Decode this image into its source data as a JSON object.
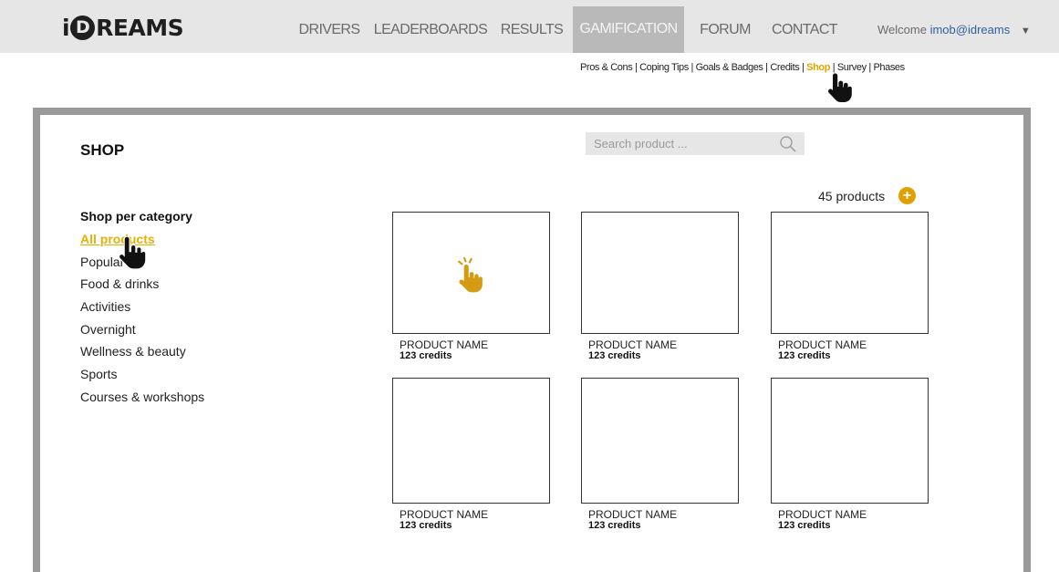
{
  "header": {
    "logo": {
      "prefix": "i",
      "mark": "D",
      "suffix": "REAMS"
    },
    "nav": [
      {
        "label": "DRIVERS",
        "active": false
      },
      {
        "label": "LEADERBOARDS",
        "active": false
      },
      {
        "label": "RESULTS",
        "active": false
      },
      {
        "label": "GAMIFICATION",
        "active": true
      },
      {
        "label": "FORUM",
        "active": false
      },
      {
        "label": "CONTACT",
        "active": false
      }
    ],
    "welcome": {
      "text": "Welcome",
      "user": "imob@idreams",
      "caret": "▼"
    }
  },
  "subnav": {
    "items": [
      "Pros & Cons",
      "Coping Tips",
      "Goals & Badges",
      "Credits",
      "Shop",
      "Survey",
      "Phases"
    ],
    "active": "Shop"
  },
  "page": {
    "title": "SHOP"
  },
  "search": {
    "placeholder": "Search product ..."
  },
  "results": {
    "count_label": "45 products",
    "add_symbol": "+"
  },
  "categories": {
    "heading": "Shop per category",
    "items": [
      "All products",
      "Popular",
      "Food & drinks",
      "Activities",
      "Overnight",
      "Wellness & beauty",
      "Sports",
      "Courses & workshops"
    ],
    "active": "All products"
  },
  "products": [
    {
      "name": "PRODUCT  NAME",
      "credits": "123 credits"
    },
    {
      "name": "PRODUCT  NAME",
      "credits": "123 credits"
    },
    {
      "name": "PRODUCT  NAME",
      "credits": "123 credits"
    },
    {
      "name": "PRODUCT  NAME",
      "credits": "123 credits"
    },
    {
      "name": "PRODUCT  NAME",
      "credits": "123 credits"
    },
    {
      "name": "PRODUCT  NAME",
      "credits": "123 credits"
    }
  ],
  "colors": {
    "accent": "#e0a000",
    "nav_active_bg": "#b9b9b9",
    "topbar_bg": "#e6e6e6",
    "panel_frame": "#9a9a9a",
    "user_link": "#2f5f9e"
  },
  "icons": {
    "search": "magnifier-icon",
    "add": "plus-circle-icon",
    "cursor": "hand-pointer-icon"
  }
}
